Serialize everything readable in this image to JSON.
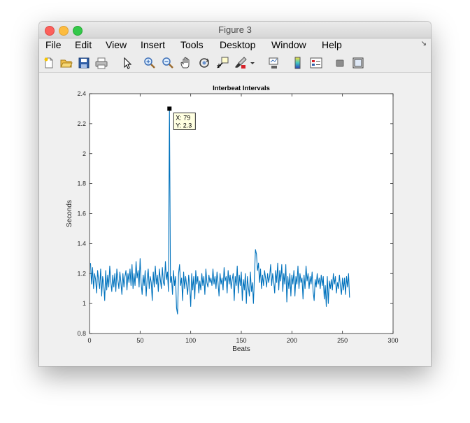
{
  "window": {
    "title": "Figure 3"
  },
  "menu": [
    "File",
    "Edit",
    "View",
    "Insert",
    "Tools",
    "Desktop",
    "Window",
    "Help"
  ],
  "toolbar": {
    "icons": [
      "new-figure-icon",
      "open-file-icon",
      "save-icon",
      "print-icon",
      "pointer-icon",
      "zoom-in-icon",
      "zoom-out-icon",
      "pan-hand-icon",
      "rotate-3d-icon",
      "data-cursor-icon",
      "brush-icon",
      "link-plot-icon",
      "colorbar-icon",
      "legend-icon",
      "hide-plot-tools-icon",
      "show-plot-tools-icon"
    ]
  },
  "chart_data": {
    "type": "line",
    "title": "Interbeat Intervals",
    "xlabel": "Beats",
    "ylabel": "Seconds",
    "xlim": [
      0,
      300
    ],
    "ylim": [
      0.8,
      2.4
    ],
    "xticks": [
      "0",
      "50",
      "100",
      "150",
      "200",
      "250",
      "300"
    ],
    "yticks": [
      "0.8",
      "1",
      "1.2",
      "1.4",
      "1.6",
      "1.8",
      "2",
      "2.2",
      "2.4"
    ],
    "grid": false,
    "series_color": "#0072bd",
    "x_start": 1,
    "y": [
      1.27,
      1.13,
      1.24,
      1.1,
      1.2,
      1.16,
      1.07,
      1.22,
      1.15,
      1.1,
      1.23,
      1.05,
      1.18,
      1.13,
      1.02,
      1.22,
      1.09,
      1.19,
      1.11,
      1.25,
      1.15,
      1.08,
      1.19,
      1.11,
      1.2,
      1.08,
      1.23,
      1.16,
      1.1,
      1.21,
      1.14,
      1.06,
      1.2,
      1.11,
      1.18,
      1.22,
      1.09,
      1.2,
      1.14,
      1.23,
      1.12,
      1.26,
      1.1,
      1.2,
      1.12,
      1.28,
      1.17,
      1.22,
      1.11,
      1.3,
      1.14,
      1.06,
      1.19,
      1.12,
      1.22,
      1.05,
      1.17,
      1.23,
      1.1,
      1.18,
      1.14,
      1.02,
      1.21,
      1.11,
      1.25,
      1.13,
      1.19,
      1.08,
      1.23,
      1.16,
      1.1,
      1.24,
      1.14,
      1.12,
      1.28,
      1.16,
      1.21,
      1.08,
      2.3,
      1.14,
      1.18,
      1.06,
      1.22,
      1.12,
      1.18,
      0.97,
      0.93,
      1.2,
      1.26,
      1.12,
      1.17,
      1.02,
      1.21,
      1.1,
      1.18,
      1.12,
      1.06,
      1.19,
      1.12,
      0.98,
      1.2,
      1.09,
      1.18,
      1.03,
      1.22,
      1.13,
      1.18,
      1.07,
      1.15,
      1.09,
      1.2,
      1.12,
      1.18,
      1.06,
      1.23,
      1.14,
      1.11,
      1.19,
      1.14,
      1.17,
      1.12,
      1.23,
      1.13,
      1.18,
      1.1,
      1.21,
      1.14,
      1.05,
      1.2,
      1.13,
      1.17,
      1.09,
      1.24,
      1.15,
      1.18,
      1.07,
      1.22,
      1.13,
      1.19,
      1.1,
      1.16,
      1.2,
      1.02,
      1.18,
      1.12,
      1.25,
      1.07,
      1.19,
      1.12,
      1.21,
      1.02,
      1.16,
      1.09,
      1.2,
      1.0,
      1.18,
      1.11,
      1.05,
      1.21,
      1.08,
      1.14,
      1.0,
      1.18,
      1.36,
      1.33,
      1.22,
      1.27,
      1.14,
      1.23,
      1.1,
      1.19,
      1.12,
      1.22,
      1.17,
      1.11,
      1.2,
      1.14,
      1.18,
      1.26,
      1.12,
      1.2,
      1.15,
      1.07,
      1.22,
      1.14,
      1.27,
      1.09,
      1.22,
      1.15,
      1.26,
      1.08,
      1.2,
      1.13,
      1.26,
      1.01,
      1.18,
      1.1,
      1.2,
      1.05,
      1.19,
      1.13,
      1.22,
      1.05,
      1.18,
      1.13,
      1.25,
      1.1,
      1.2,
      1.14,
      1.17,
      1.03,
      1.19,
      1.1,
      1.25,
      1.15,
      1.2,
      1.1,
      1.18,
      1.13,
      1.21,
      1.08,
      1.02,
      1.16,
      1.11,
      1.2,
      1.13,
      1.17,
      1.1,
      1.19,
      1.12,
      1.18,
      1.03,
      1.12,
      0.98,
      1.18,
      1.0,
      1.15,
      1.1,
      1.16,
      1.09,
      1.2,
      1.13,
      1.18,
      1.07,
      1.14,
      1.1,
      1.19,
      1.11,
      1.06,
      1.17,
      1.09,
      1.17,
      1.06,
      1.18,
      1.11,
      1.2,
      1.04
    ],
    "annotations": [
      {
        "x": 79,
        "y": 2.3,
        "text_x": "X: 79",
        "text_y": "Y: 2.3"
      }
    ]
  }
}
